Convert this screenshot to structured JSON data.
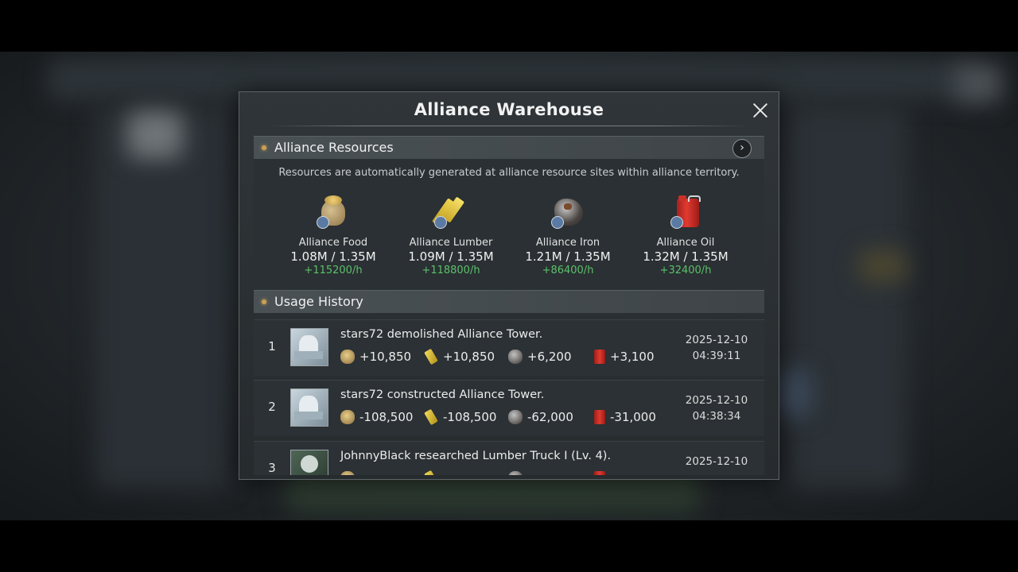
{
  "dialog": {
    "title": "Alliance Warehouse"
  },
  "resources": {
    "header": "Alliance Resources",
    "description": "Resources are automatically generated at alliance resource sites within alliance territory.",
    "items": [
      {
        "name": "Alliance Food",
        "amount": "1.08M / 1.35M",
        "rate": "+115200/h",
        "icon": "food-sack-icon"
      },
      {
        "name": "Alliance Lumber",
        "amount": "1.09M / 1.35M",
        "rate": "+118800/h",
        "icon": "lumber-icon"
      },
      {
        "name": "Alliance Iron",
        "amount": "1.21M / 1.35M",
        "rate": "+86400/h",
        "icon": "iron-ore-icon"
      },
      {
        "name": "Alliance Oil",
        "amount": "1.32M / 1.35M",
        "rate": "+32400/h",
        "icon": "oil-can-icon"
      }
    ]
  },
  "history": {
    "header": "Usage History",
    "rows": [
      {
        "index": "1",
        "description": "stars72 demolished Alliance Tower.",
        "food": "+10,850",
        "lumber": "+10,850",
        "iron": "+6,200",
        "oil": "+3,100",
        "date": "2025-12-10",
        "time": "04:39:11"
      },
      {
        "index": "2",
        "description": "stars72 constructed Alliance Tower.",
        "food": "-108,500",
        "lumber": "-108,500",
        "iron": "-62,000",
        "oil": "-31,000",
        "date": "2025-12-10",
        "time": "04:38:34"
      },
      {
        "index": "3",
        "description": "JohnnyBlack researched Lumber Truck I (Lv. 4).",
        "food": "",
        "lumber": "",
        "iron": "",
        "oil": "",
        "date": "2025-12-10",
        "time": ""
      }
    ]
  },
  "colors": {
    "positive_rate": "#5cc06a",
    "accent_dot": "#c9a056"
  }
}
